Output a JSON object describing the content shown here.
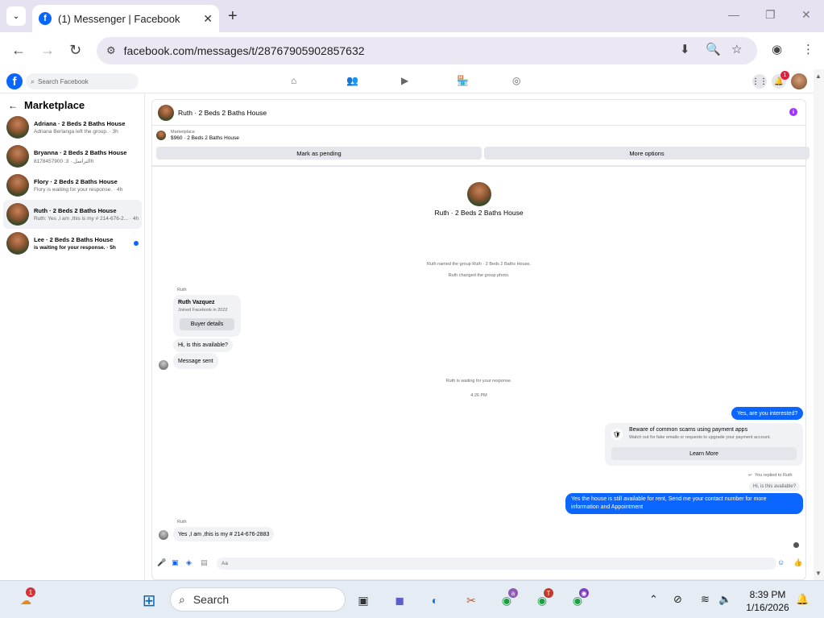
{
  "browser": {
    "tab_title": "(1) Messenger | Facebook",
    "url": "facebook.com/messages/t/28767905902857632"
  },
  "fb": {
    "search_placeholder": "Search Facebook",
    "notif_count": "1"
  },
  "sidebar": {
    "title": "Marketplace",
    "conversations": [
      {
        "name": "Adriana · 2 Beds 2 Baths House",
        "sub": "Adriana Berlanga left the group. · 3h"
      },
      {
        "name": "Bryanna · 2 Beds 2 Baths House",
        "sub": "8178457900 :التراسل · 3h"
      },
      {
        "name": "Flory · 2 Beds 2 Baths House",
        "sub": "Flory is waiting for your response. · 4h"
      },
      {
        "name": "Ruth · 2 Beds 2 Baths House",
        "sub": "Ruth: Yes ,I am ,this is my # 214-676-2... · 4h"
      },
      {
        "name": "Lee · 2 Beds 2 Baths House",
        "sub": "is waiting for your response. · 5h"
      }
    ]
  },
  "chat": {
    "title": "Ruth · 2 Beds 2 Baths House",
    "listing_label": "Marketplace",
    "listing_price": "$960 · 2 Beds 2 Baths House",
    "mark_pending": "Mark as pending",
    "more_options": "More options",
    "center_name": "Ruth · 2 Beds 2 Baths House",
    "sys1": "Ruth named the group Ruth · 2 Beds 2 Baths House.",
    "sys2": "Ruth changed the group photo.",
    "sender1": "Ruth",
    "card_name": "Ruth Vazquez",
    "card_sub": "Joined Facebook in 2022",
    "card_btn": "Buyer details",
    "msg1": "Hi, is this available?",
    "msg2": "Message sent",
    "sys3": "Ruth is waiting for your response.",
    "time1": "4:26 PM",
    "out1": "Yes, are you interested?",
    "scam_title": "Beware of common scams using payment apps",
    "scam_sub": "Watch out for fake emails or requests to upgrade your payment account.",
    "learn_more": "Learn More",
    "replied_label": "You replied to Ruth",
    "quoted": "Hi, is this available?",
    "out2_line1": "Yes the house is still available for rent, Send me your contact number for more",
    "out2_line2": "information and Appointment",
    "sender2": "Ruth",
    "msg3": "Yes ,I am ,this is my # 214-676-2883",
    "composer_placeholder": "Aa"
  },
  "taskbar": {
    "search": "Search",
    "time": "8:39 PM",
    "date": "1/16/2026",
    "weather_badge": "1",
    "chrome_badge_a": "a",
    "chrome_badge_t": "T"
  }
}
